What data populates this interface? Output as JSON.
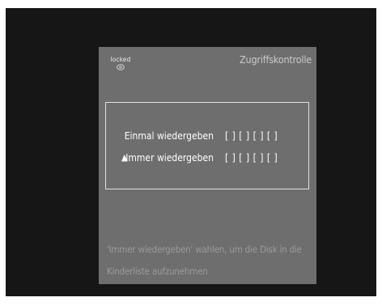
{
  "panel": {
    "status_label": "locked",
    "status_icon": "disc-icon",
    "title": "Zugriffskontrolle"
  },
  "options": [
    {
      "label": "Einmal wiedergeben",
      "value": "[ ] [ ] [ ] [ ]",
      "selected": false
    },
    {
      "label": "Immer wiedergeben",
      "value": "[ ] [ ] [ ] [ ]",
      "selected": true
    }
  ],
  "cursor": "▲",
  "hint": {
    "line1": "'Immer wiedergeben' wahlen,  um die Disk in die",
    "line2": "Kinderliste aufzunehmen"
  },
  "colors": {
    "background": "#161616",
    "panel": "#6e6e6e",
    "title": "#cacaca",
    "hint": "#9a9a9a"
  }
}
